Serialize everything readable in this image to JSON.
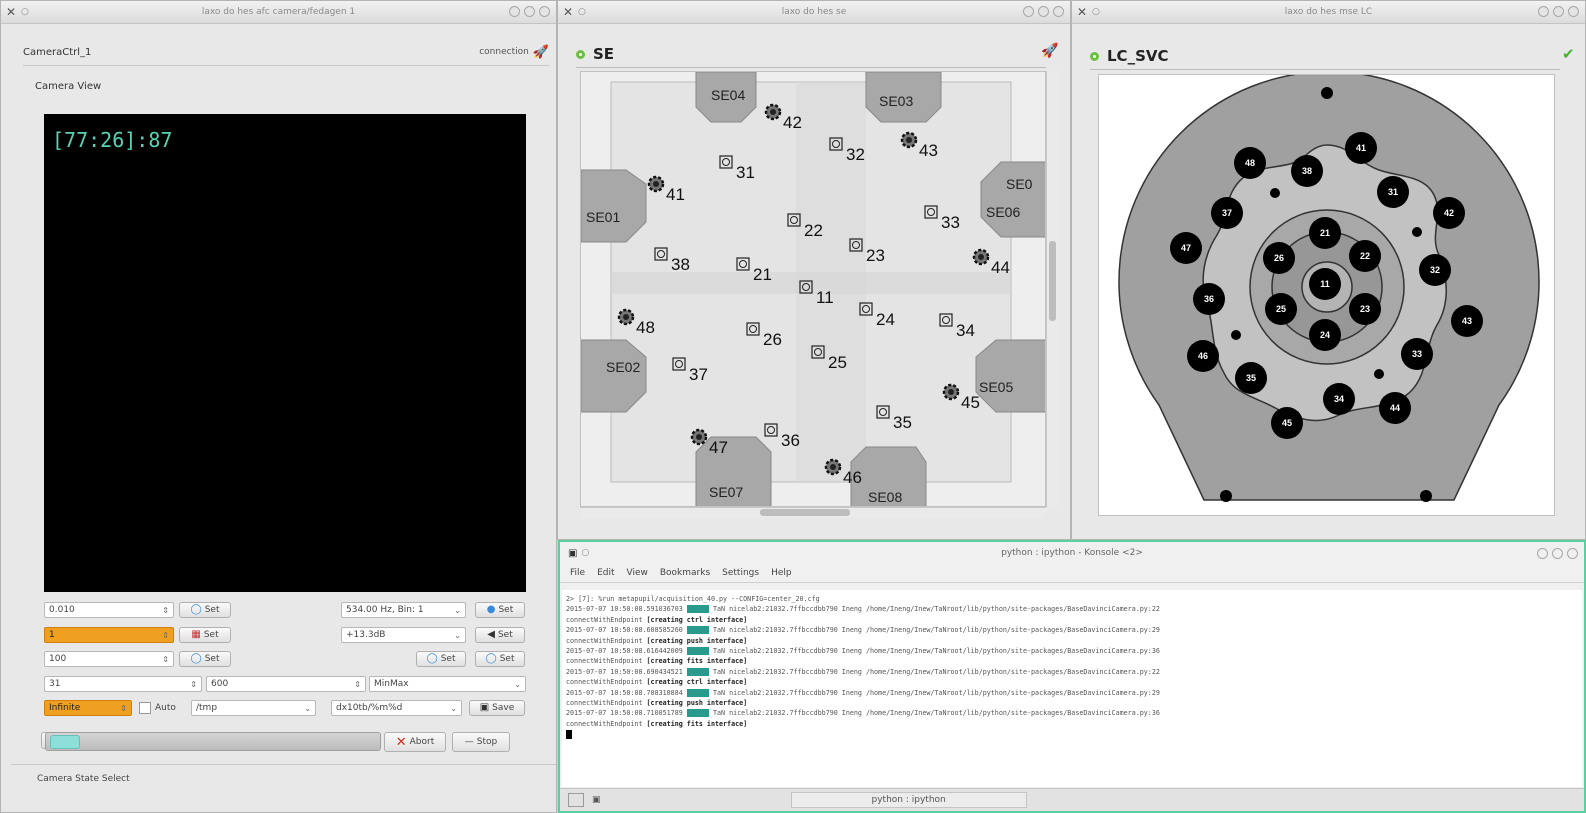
{
  "camera_window": {
    "title": "laxo do hes afc camera/fedagen 1",
    "header_title": "CameraCtrl_1",
    "connection_label": "connection",
    "section_label": "Camera View",
    "coord_text": "[77:26]:87",
    "controls": {
      "exposure_value": "0.010",
      "frames_value": "1",
      "gain_value": "100",
      "roi_x": "31",
      "roi_y": "600",
      "infinite_value": "Infinite",
      "auto_label": "Auto",
      "path_value": "/tmp",
      "pattern_value": "dx10tb/%m%d",
      "rate_select": "534.00 Hz, Bin: 1",
      "gain_select": "+13.3dB",
      "scale_select": "MinMax",
      "set_label": "Set",
      "save_label": "Save",
      "abort_label": "Abort",
      "stop_label": "Stop",
      "slider_level_pct": 0
    },
    "status_text": "Camera State Select"
  },
  "se_window": {
    "title": "laxo do hes se",
    "panel_title": "SE",
    "fibers": [
      {
        "label": "42",
        "type": "gear"
      },
      {
        "label": "43",
        "type": "gear"
      },
      {
        "label": "41",
        "type": "gear"
      },
      {
        "label": "44",
        "type": "gear"
      },
      {
        "label": "48",
        "type": "gear"
      },
      {
        "label": "45",
        "type": "gear"
      },
      {
        "label": "47",
        "type": "gear"
      },
      {
        "label": "46",
        "type": "gear"
      },
      {
        "label": "31",
        "type": "box"
      },
      {
        "label": "32",
        "type": "box"
      },
      {
        "label": "33",
        "type": "box"
      },
      {
        "label": "22",
        "type": "box"
      },
      {
        "label": "23",
        "type": "box"
      },
      {
        "label": "38",
        "type": "box"
      },
      {
        "label": "21",
        "type": "box"
      },
      {
        "label": "11",
        "type": "box"
      },
      {
        "label": "24",
        "type": "box"
      },
      {
        "label": "34",
        "type": "box"
      },
      {
        "label": "26",
        "type": "box"
      },
      {
        "label": "25",
        "type": "box"
      },
      {
        "label": "37",
        "type": "box"
      },
      {
        "label": "35",
        "type": "box"
      },
      {
        "label": "36",
        "type": "box"
      }
    ],
    "se_labels": [
      "SE04",
      "SE03",
      "SE01",
      "SE06",
      "SE02",
      "SE05",
      "SE07",
      "SE08",
      "SE0"
    ]
  },
  "lc_window": {
    "title": "laxo do hes mse LC",
    "panel_title": "LC_SVC",
    "circles": [
      "41",
      "48",
      "38",
      "31",
      "37",
      "42",
      "47",
      "21",
      "22",
      "26",
      "11",
      "32",
      "36",
      "25",
      "23",
      "43",
      "24",
      "46",
      "33",
      "35",
      "34",
      "44",
      "45"
    ]
  },
  "terminal": {
    "title": "python : ipython - Konsole <2>",
    "menu": [
      "File",
      "Edit",
      "View",
      "Bookmarks",
      "Settings",
      "Help"
    ],
    "prompt": "2> [7]: %run metapupil/acquisition_40.py --CONFIG=center_20.cfg",
    "lines": [
      {
        "ts": "2015-07-07 10:50:08.591036703",
        "tag": "DEBUG",
        "msg": "TaN nicelab2:21032.7ffbccdbb790 Ineng /home/Ineng/Inew/TaNroot/lib/python/site-packages/BaseDavinciCamera.py:22",
        "cont": "connectWithEndpoint ",
        "bold": "[creating ctrl interface]"
      },
      {
        "ts": "2015-07-07 10:50:08.608585260",
        "tag": "DEBUG",
        "msg": "TaN nicelab2:21032.7ffbccdbb790 Ineng /home/Ineng/Inew/TaNroot/lib/python/site-packages/BaseDavinciCamera.py:29",
        "cont": "connectWithEndpoint ",
        "bold": "[creating push interface]"
      },
      {
        "ts": "2015-07-07 10:50:08.616442009",
        "tag": "DEBUG",
        "msg": "TaN nicelab2:21032.7ffbccdbb790 Ineng /home/Ineng/Inew/TaNroot/lib/python/site-packages/BaseDavinciCamera.py:36",
        "cont": "connectWithEndpoint ",
        "bold": "[creating fits interface]"
      },
      {
        "ts": "2015-07-07 10:50:08.690434521",
        "tag": "DEBUG",
        "msg": "TaN nicelab2:21032.7ffbccdbb790 Ineng /home/Ineng/Inew/TaNroot/lib/python/site-packages/BaseDavinciCamera.py:22",
        "cont": "connectWithEndpoint ",
        "bold": "[creating ctrl interface]"
      },
      {
        "ts": "2015-07-07 10:50:08.708310884",
        "tag": "DEBUG",
        "msg": "TaN nicelab2:21032.7ffbccdbb790 Ineng /home/Ineng/Inew/TaNroot/lib/python/site-packages/BaseDavinciCamera.py:29",
        "cont": "connectWithEndpoint ",
        "bold": "[creating push interface]"
      },
      {
        "ts": "2015-07-07 10:50:08.710051789",
        "tag": "DEBUG",
        "msg": "TaN nicelab2:21032.7ffbccdbb790 Ineng /home/Ineng/Inew/TaNroot/lib/python/site-packages/BaseDavinciCamera.py:36",
        "cont": "connectWithEndpoint ",
        "bold": "[creating fits interface]"
      }
    ],
    "tab_label": "python : ipython"
  },
  "colors": {
    "accent": "#5ccfa0",
    "orange": "#f0a020",
    "teal_text": "#58d3b6",
    "ok_green": "#6ac040"
  }
}
